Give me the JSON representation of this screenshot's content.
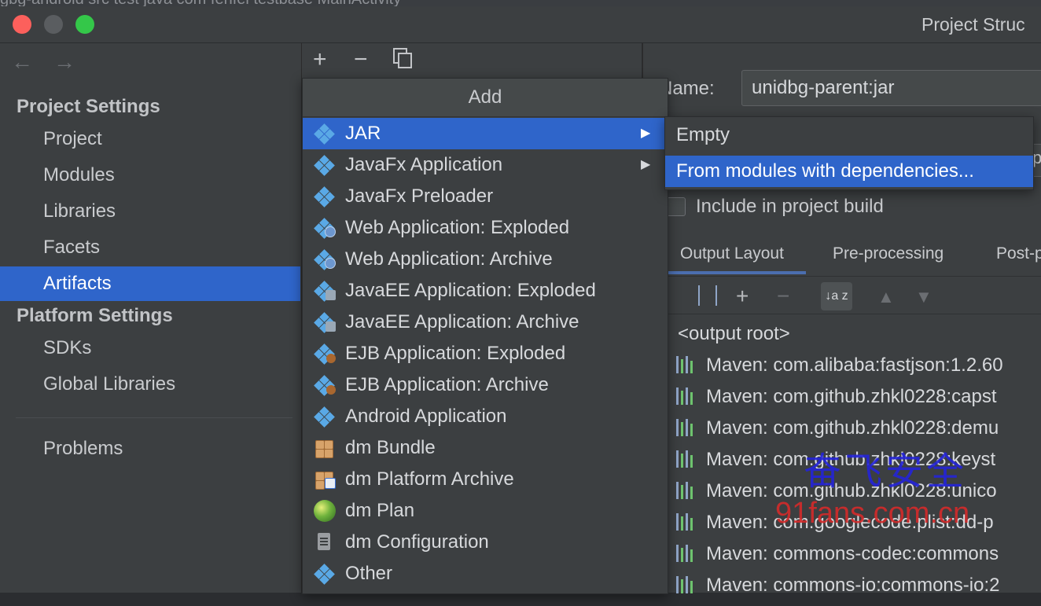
{
  "breadcrumb": "gbg-android  src  test  java  com  fenfei  testbase  MainActivity",
  "window": {
    "title": "Project Struc"
  },
  "sidebar": {
    "project_settings_title": "Project Settings",
    "project_items": [
      "Project",
      "Modules",
      "Libraries",
      "Facets",
      "Artifacts"
    ],
    "selected": "Artifacts",
    "platform_settings_title": "Platform Settings",
    "platform_items": [
      "SDKs",
      "Global Libraries"
    ],
    "problems": "Problems"
  },
  "toolbar": {
    "add": "+",
    "remove": "−"
  },
  "popup": {
    "title": "Add",
    "items": [
      {
        "label": "JAR",
        "icon": "jar-icon",
        "submenu": true,
        "selected": true
      },
      {
        "label": "JavaFx Application",
        "icon": "javafx-icon",
        "submenu": true
      },
      {
        "label": "JavaFx Preloader",
        "icon": "javafx-icon"
      },
      {
        "label": "Web Application: Exploded",
        "icon": "web-app-icon"
      },
      {
        "label": "Web Application: Archive",
        "icon": "web-app-icon"
      },
      {
        "label": "JavaEE Application: Exploded",
        "icon": "javaee-icon"
      },
      {
        "label": "JavaEE Application: Archive",
        "icon": "javaee-icon"
      },
      {
        "label": "EJB Application: Exploded",
        "icon": "ejb-icon"
      },
      {
        "label": "EJB Application: Archive",
        "icon": "ejb-icon"
      },
      {
        "label": "Android Application",
        "icon": "android-app-icon"
      },
      {
        "label": "dm Bundle",
        "icon": "bundle-icon"
      },
      {
        "label": "dm Platform Archive",
        "icon": "platform-archive-icon"
      },
      {
        "label": "dm Plan",
        "icon": "plan-icon"
      },
      {
        "label": "dm Configuration",
        "icon": "configuration-icon"
      },
      {
        "label": "Other",
        "icon": "other-icon"
      }
    ]
  },
  "submenu": {
    "items": [
      "Empty",
      "From modules with dependencies..."
    ],
    "selected": "From modules with dependencies..."
  },
  "details": {
    "name_label": "Name:",
    "name_value": "unidbg-parent:jar",
    "partial_field": "p",
    "include_label": "Include in project build",
    "tabs": [
      "Output Layout",
      "Pre-processing",
      "Post-p"
    ],
    "sort_label": "↓a z",
    "output_root": "<output root>",
    "tree_items": [
      "Maven: com.alibaba:fastjson:1.2.60",
      "Maven: com.github.zhkl0228:capst",
      "Maven: com.github.zhkl0228:demu",
      "Maven: com.github.zhkl0228:keyst",
      "Maven: com.github.zhkl0228:unico",
      "Maven: com.googlecode.plist:dd-p",
      "Maven: commons-codec:commons",
      "Maven: commons-io:commons-io:2"
    ]
  },
  "watermark": {
    "text_cn": "奋飞安全",
    "url": "91fans.com.cn"
  },
  "colors": {
    "selection": "#2f65ca",
    "panel": "#3c3f41"
  }
}
